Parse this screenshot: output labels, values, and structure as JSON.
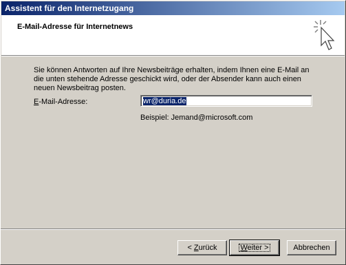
{
  "window": {
    "title": "Assistent für den Internetzugang"
  },
  "header": {
    "title": "E-Mail-Adresse für Internetnews"
  },
  "content": {
    "description": "Sie können Antworten auf Ihre Newsbeiträge erhalten, indem Ihnen eine E-Mail an die unten stehende Adresse geschickt wird, oder der Absender kann auch einen neuen Newsbeitrag posten.",
    "email_label_mnemonic": "E",
    "email_label_rest": "-Mail-Adresse:",
    "email_value": "wr@duria.de",
    "example": "Beispiel: Jemand@microsoft.com"
  },
  "buttons": {
    "back_prefix": "< ",
    "back_mnemonic": "Z",
    "back_rest": "urück",
    "next_mnemonic": "W",
    "next_rest": "eiter >",
    "cancel": "Abbrechen"
  },
  "icons": {
    "wizard": "wizard-sparkle-cursor-icon"
  }
}
